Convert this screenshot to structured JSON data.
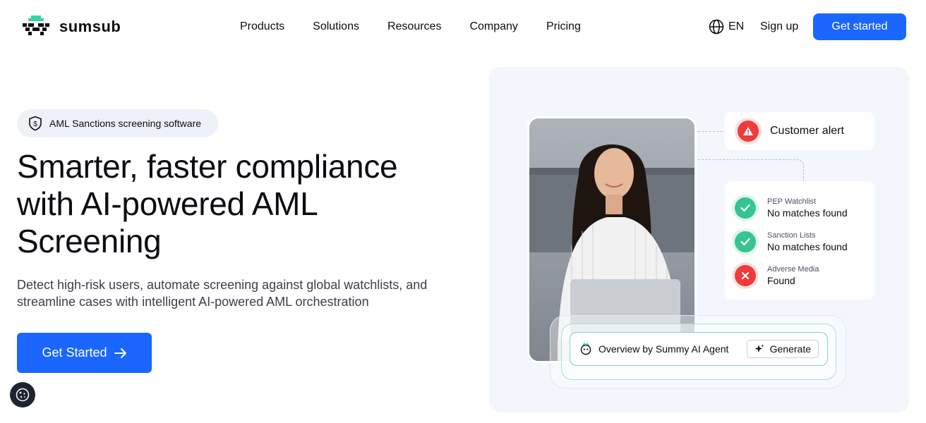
{
  "nav": {
    "brand": "sumsub",
    "links": [
      "Products",
      "Solutions",
      "Resources",
      "Company",
      "Pricing"
    ],
    "language": "EN",
    "signup": "Sign up",
    "cta": "Get started"
  },
  "hero": {
    "badge": "AML Sanctions screening software",
    "headline_lines": [
      "Smarter, faster compliance",
      "with AI-powered AML",
      "Screening"
    ],
    "subtext_lines": [
      "Detect high-risk users, automate screening against global watchlists, and",
      "streamline cases with intelligent AI-powered AML orchestration"
    ],
    "cta": "Get Started"
  },
  "illustration": {
    "alert": "Customer alert",
    "checks": [
      {
        "label": "PEP Watchlist",
        "value": "No matches found",
        "status": "ok"
      },
      {
        "label": "Sanction Lists",
        "value": "No matches found",
        "status": "ok"
      },
      {
        "label": "Adverse Media",
        "value": "Found",
        "status": "bad"
      }
    ],
    "ai_text": "Overview by Summy AI Agent",
    "ai_button": "Generate"
  },
  "colors": {
    "accent": "#1a66ff",
    "ok": "#37c493",
    "alert": "#ef3b3b",
    "text": "#0b0d12"
  }
}
